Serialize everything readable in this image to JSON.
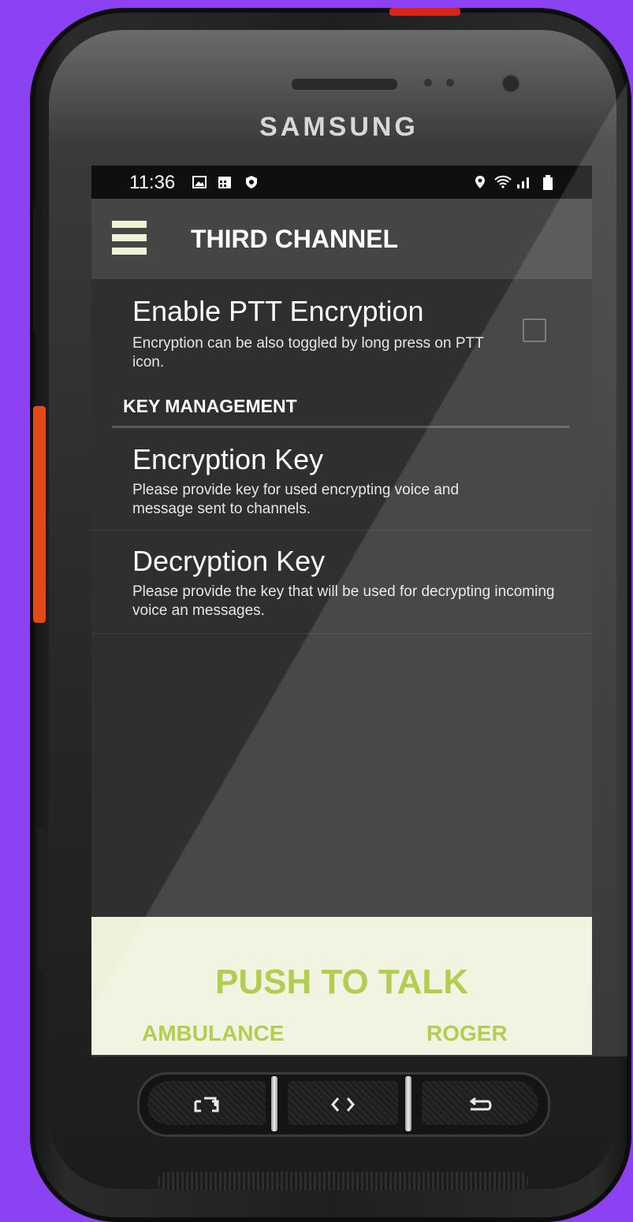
{
  "device": {
    "brand": "SAMSUNG"
  },
  "status_bar": {
    "time": "11:36",
    "left_icons": [
      "gallery-icon",
      "calendar-icon",
      "shield-icon"
    ],
    "right_icons": [
      "location-icon",
      "wifi-icon",
      "signal-icon",
      "battery-icon"
    ]
  },
  "app_bar": {
    "title": "THIRD CHANNEL",
    "menu_icon": "hamburger-menu-icon"
  },
  "preferences": {
    "ptt_encryption": {
      "title": "Enable PTT Encryption",
      "summary": "Encryption can be also toggled by long press on PTT icon.",
      "checked": false
    },
    "section_header": "KEY MANAGEMENT",
    "encryption_key": {
      "title": "Encryption Key",
      "summary": "Please provide key for used encrypting voice and message sent to channels."
    },
    "decryption_key": {
      "title": "Decryption Key",
      "summary": "Please provide the key that will be used for decrypting incoming voice an messages."
    }
  },
  "ptt_panel": {
    "label": "PUSH TO TALK",
    "left_label": "AMBULANCE",
    "right_label": "ROGER"
  },
  "colors": {
    "background": "#8c41f2",
    "app_bar": "#454545",
    "screen_bg": "#2f2f2f",
    "ptt_bg": "#eef2dc",
    "ptt_text": "#a7c73a",
    "menu_icon": "#eef2d6"
  }
}
